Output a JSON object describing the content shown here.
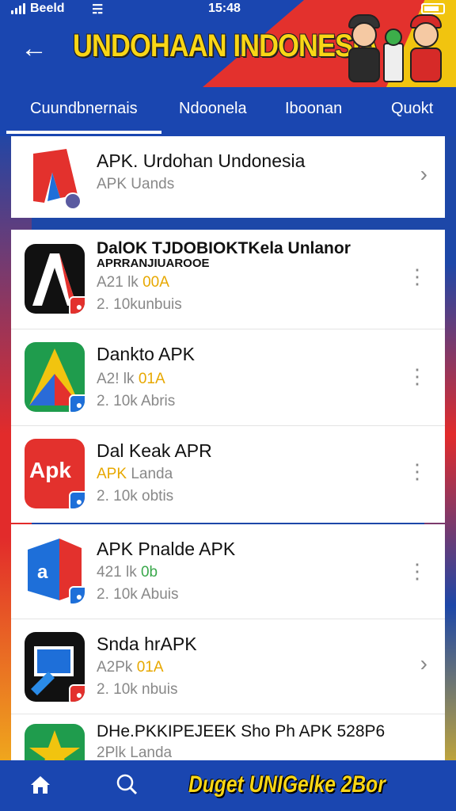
{
  "status": {
    "carrier": "Beeld",
    "time": "15:48",
    "wifi_icon": "wifi-icon"
  },
  "header": {
    "title": "UNDOHAAN INDONESIA",
    "back_icon": "back-arrow-icon"
  },
  "tabs": [
    {
      "label": "Cuundbnernais",
      "active": true
    },
    {
      "label": "Ndoonela"
    },
    {
      "label": "Iboonan"
    },
    {
      "label": "Quokt"
    }
  ],
  "featured": {
    "name": "APK. Urdohan Undonesia",
    "sub": "APK   Uands"
  },
  "apps": [
    {
      "name": "DalOK TJDOBIOKTKela Unlanor",
      "name2": "APRRANJIUAROOE",
      "meta": "A21 lk",
      "tag": "00A",
      "stats": "2. 10kunbuis",
      "action": "more"
    },
    {
      "name": "Dankto APK",
      "meta": "A2! lk",
      "tag": "01A",
      "stats": "2.  10k  Abris",
      "action": "more"
    },
    {
      "name": "Dal Keak APR",
      "meta": "APK",
      "meta2": "Landa",
      "stats": "2.  10k  obtis",
      "action": "more"
    },
    {
      "name": "APK Pnalde APK",
      "meta": "421 lk",
      "tag": "0b",
      "stats": "2.  10k  Abuis",
      "action": "more"
    },
    {
      "name": "Snda hrAPK",
      "meta": "A2Pk",
      "tag": "01A",
      "stats": "2.  10k  nbuis",
      "action": "chevron"
    },
    {
      "name": "DHe.PKKIPEJEEK Sho Ph APK 528P6",
      "meta": "2Plk",
      "meta2": "Landa",
      "action": "more"
    }
  ],
  "bottom_nav": {
    "promo": "Duget UNIGelke 2Bor"
  },
  "colors": {
    "header_blue": "#1a46b0",
    "accent_yellow": "#f9d616",
    "accent_red": "#e3312d"
  }
}
